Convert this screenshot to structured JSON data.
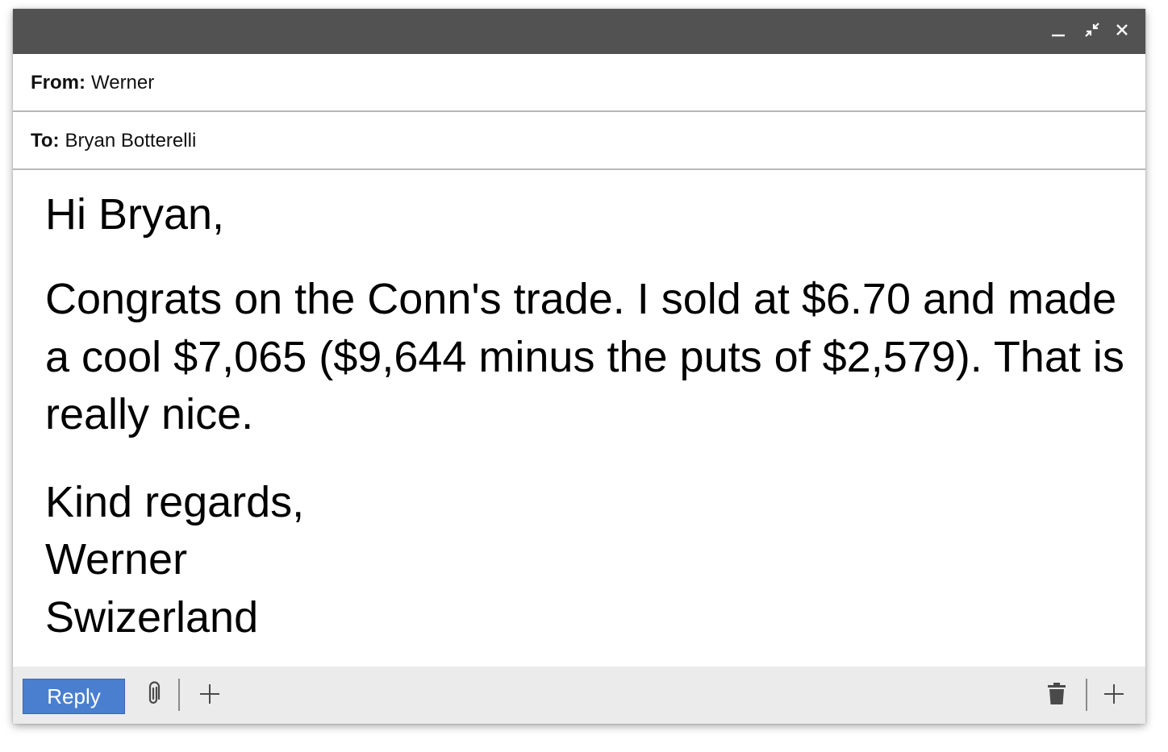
{
  "window": {
    "controls": {
      "minimize_icon": "minimize-icon",
      "collapse_icon": "collapse-arrows-icon",
      "close_icon": "close-icon"
    }
  },
  "header": {
    "from_label": "From:",
    "from_value": "Werner",
    "to_label": "To:",
    "to_value": "Bryan Botterelli"
  },
  "message": {
    "greeting": "Hi Bryan,",
    "paragraph": "Congrats on the Conn's trade. I sold at $6.70 and made a cool $7,065 ($9,644 minus the puts of $2,579). That is really nice.",
    "closing": "Kind regards,",
    "signature_name": "Werner",
    "signature_location": "Swizerland"
  },
  "footer": {
    "reply_label": "Reply",
    "icons": [
      "paperclip-icon",
      "plus-icon",
      "trash-icon",
      "plus-icon"
    ]
  },
  "colors": {
    "titlebar": "#525252",
    "reply_button": "#4a7fcf",
    "footer_bg": "#ebebeb"
  }
}
